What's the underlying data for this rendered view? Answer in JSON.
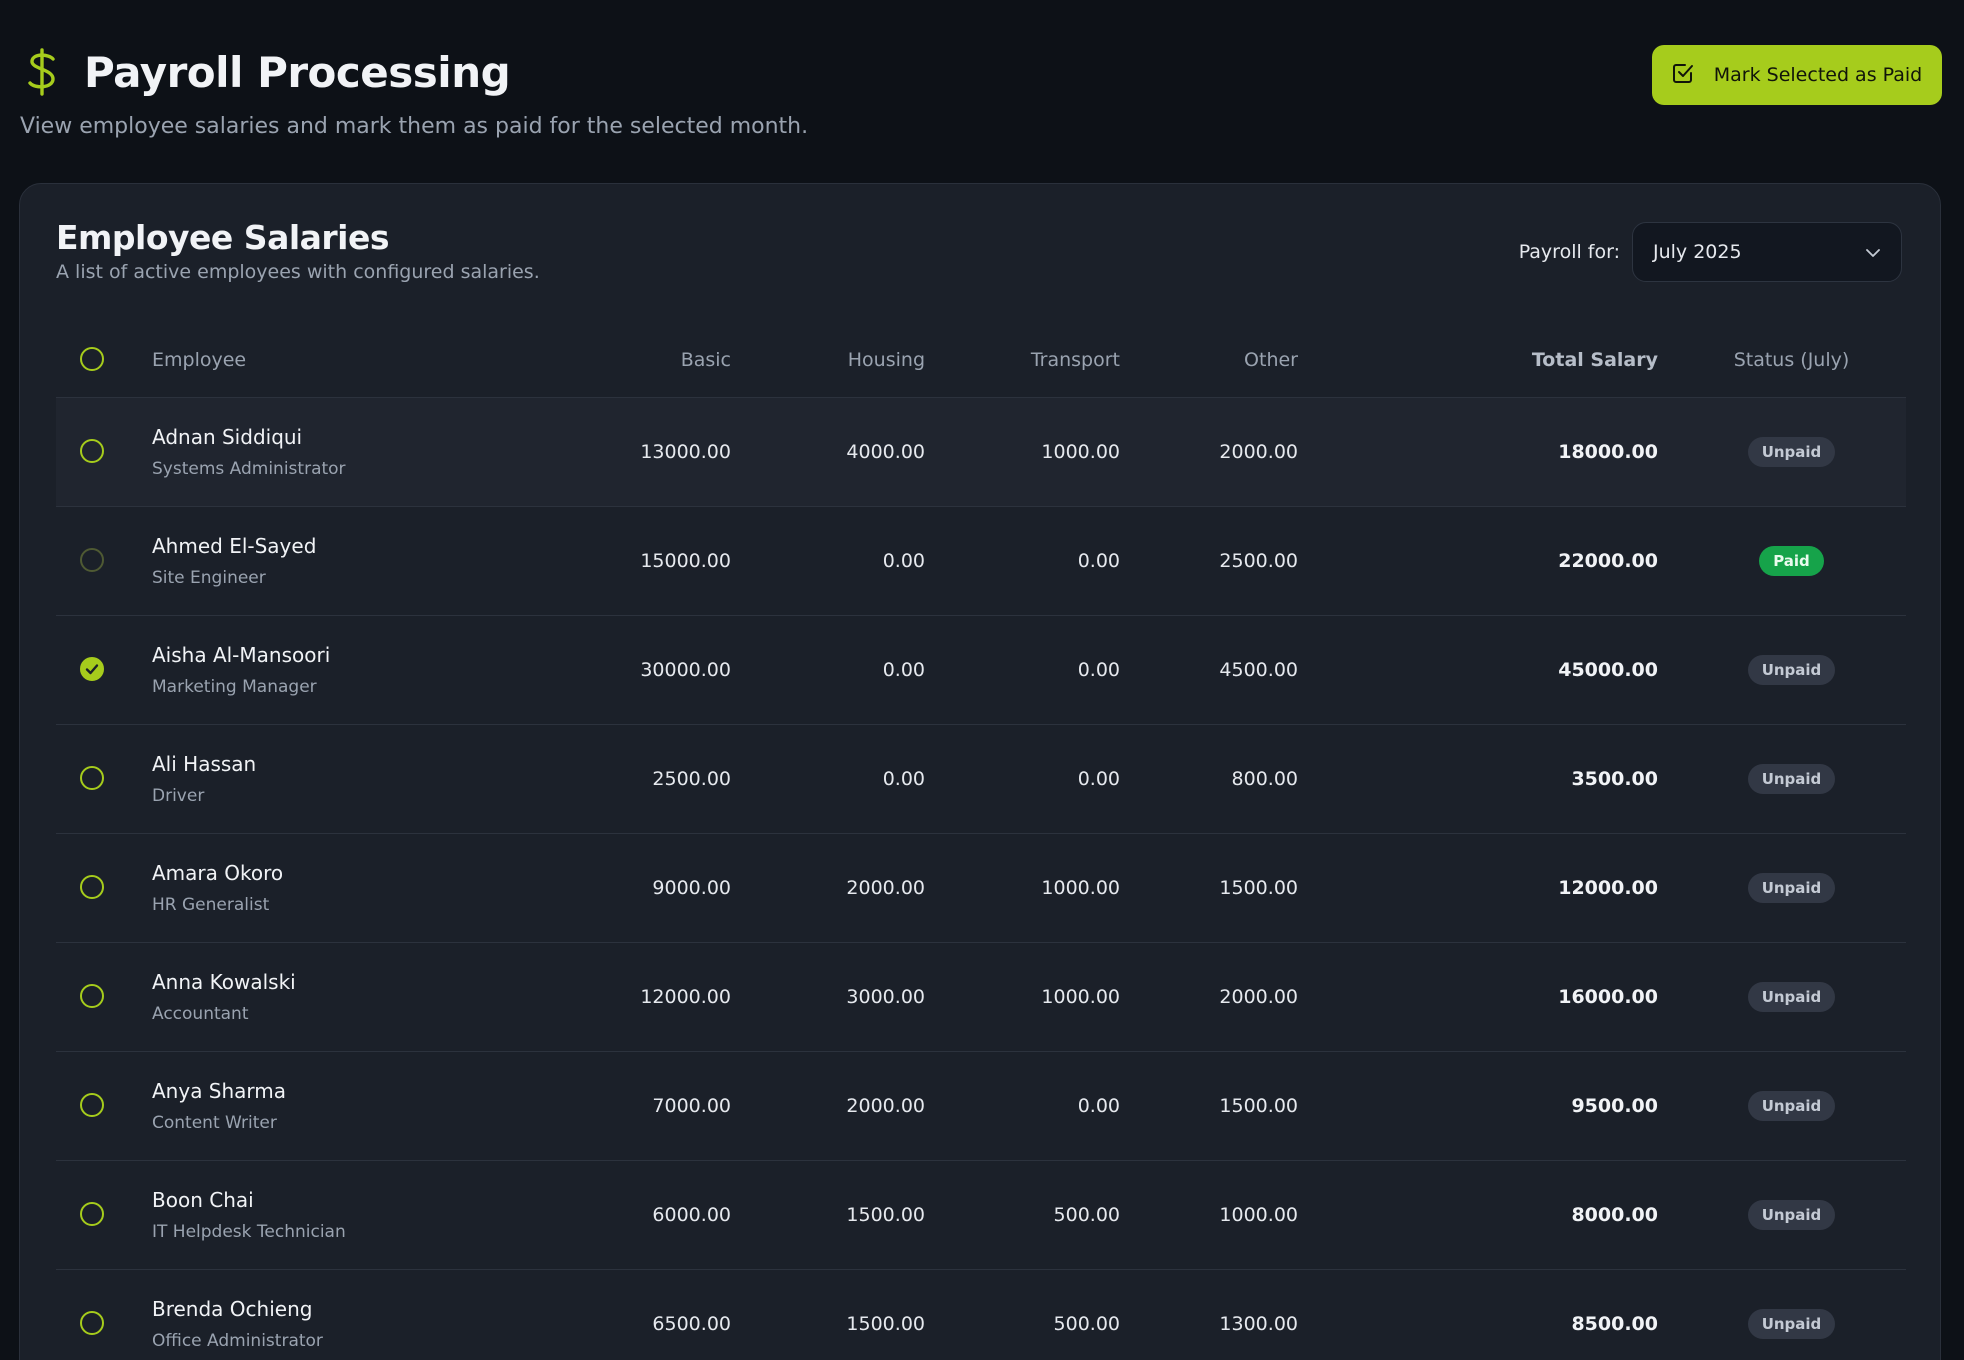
{
  "header": {
    "title": "Payroll Processing",
    "subtitle": "View employee salaries and mark them as paid for the selected month.",
    "action_label": "Mark Selected as Paid",
    "icon": "dollar-icon"
  },
  "card": {
    "title": "Employee Salaries",
    "subtitle": "A list of active employees with configured salaries.",
    "payroll_label": "Payroll for:",
    "selected_month": "July 2025"
  },
  "table": {
    "columns": {
      "employee": "Employee",
      "basic": "Basic",
      "housing": "Housing",
      "transport": "Transport",
      "other": "Other",
      "total": "Total Salary",
      "status": "Status (July)"
    },
    "rows": [
      {
        "name": "Adnan Siddiqui",
        "role": "Systems Administrator",
        "basic": "13000.00",
        "housing": "4000.00",
        "transport": "1000.00",
        "other": "2000.00",
        "total": "18000.00",
        "status": "Unpaid",
        "selected": false
      },
      {
        "name": "Ahmed El-Sayed",
        "role": "Site Engineer",
        "basic": "15000.00",
        "housing": "0.00",
        "transport": "0.00",
        "other": "2500.00",
        "total": "22000.00",
        "status": "Paid",
        "selected": false
      },
      {
        "name": "Aisha Al-Mansoori",
        "role": "Marketing Manager",
        "basic": "30000.00",
        "housing": "0.00",
        "transport": "0.00",
        "other": "4500.00",
        "total": "45000.00",
        "status": "Unpaid",
        "selected": true
      },
      {
        "name": "Ali Hassan",
        "role": "Driver",
        "basic": "2500.00",
        "housing": "0.00",
        "transport": "0.00",
        "other": "800.00",
        "total": "3500.00",
        "status": "Unpaid",
        "selected": false
      },
      {
        "name": "Amara Okoro",
        "role": "HR Generalist",
        "basic": "9000.00",
        "housing": "2000.00",
        "transport": "1000.00",
        "other": "1500.00",
        "total": "12000.00",
        "status": "Unpaid",
        "selected": false
      },
      {
        "name": "Anna Kowalski",
        "role": "Accountant",
        "basic": "12000.00",
        "housing": "3000.00",
        "transport": "1000.00",
        "other": "2000.00",
        "total": "16000.00",
        "status": "Unpaid",
        "selected": false
      },
      {
        "name": "Anya Sharma",
        "role": "Content Writer",
        "basic": "7000.00",
        "housing": "2000.00",
        "transport": "0.00",
        "other": "1500.00",
        "total": "9500.00",
        "status": "Unpaid",
        "selected": false
      },
      {
        "name": "Boon Chai",
        "role": "IT Helpdesk Technician",
        "basic": "6000.00",
        "housing": "1500.00",
        "transport": "500.00",
        "other": "1000.00",
        "total": "8000.00",
        "status": "Unpaid",
        "selected": false
      },
      {
        "name": "Brenda Ochieng",
        "role": "Office Administrator",
        "basic": "6500.00",
        "housing": "1500.00",
        "transport": "500.00",
        "other": "1300.00",
        "total": "8500.00",
        "status": "Unpaid",
        "selected": false
      }
    ]
  },
  "colors": {
    "accent": "#a6cc1c",
    "paid": "#16a34a",
    "background": "#0d1117",
    "card": "#1b2029"
  }
}
